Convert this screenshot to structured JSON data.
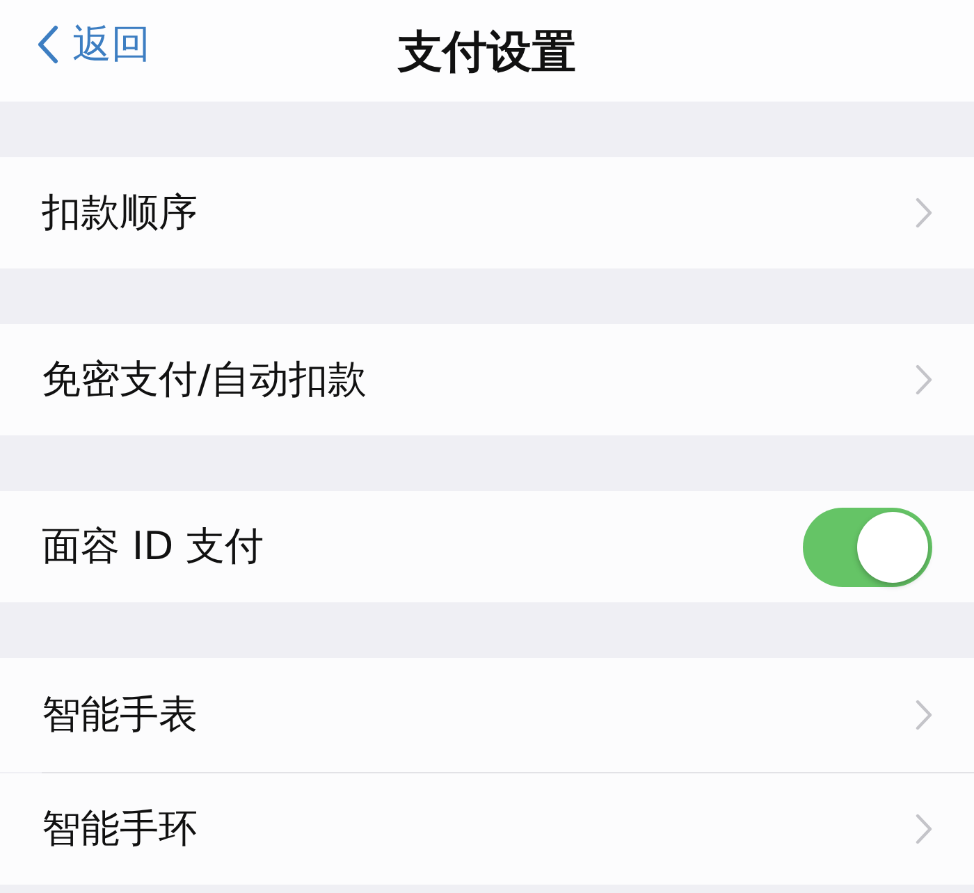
{
  "nav": {
    "back": "返回",
    "title": "支付设置"
  },
  "groups": [
    {
      "items": [
        {
          "kind": "link",
          "label": "扣款顺序"
        }
      ]
    },
    {
      "items": [
        {
          "kind": "link",
          "label": "免密支付/自动扣款"
        }
      ]
    },
    {
      "items": [
        {
          "kind": "toggle",
          "label": "面容 ID 支付",
          "on": true
        }
      ]
    },
    {
      "items": [
        {
          "kind": "link",
          "label": "智能手表"
        },
        {
          "kind": "link",
          "label": "智能手环"
        }
      ]
    }
  ]
}
